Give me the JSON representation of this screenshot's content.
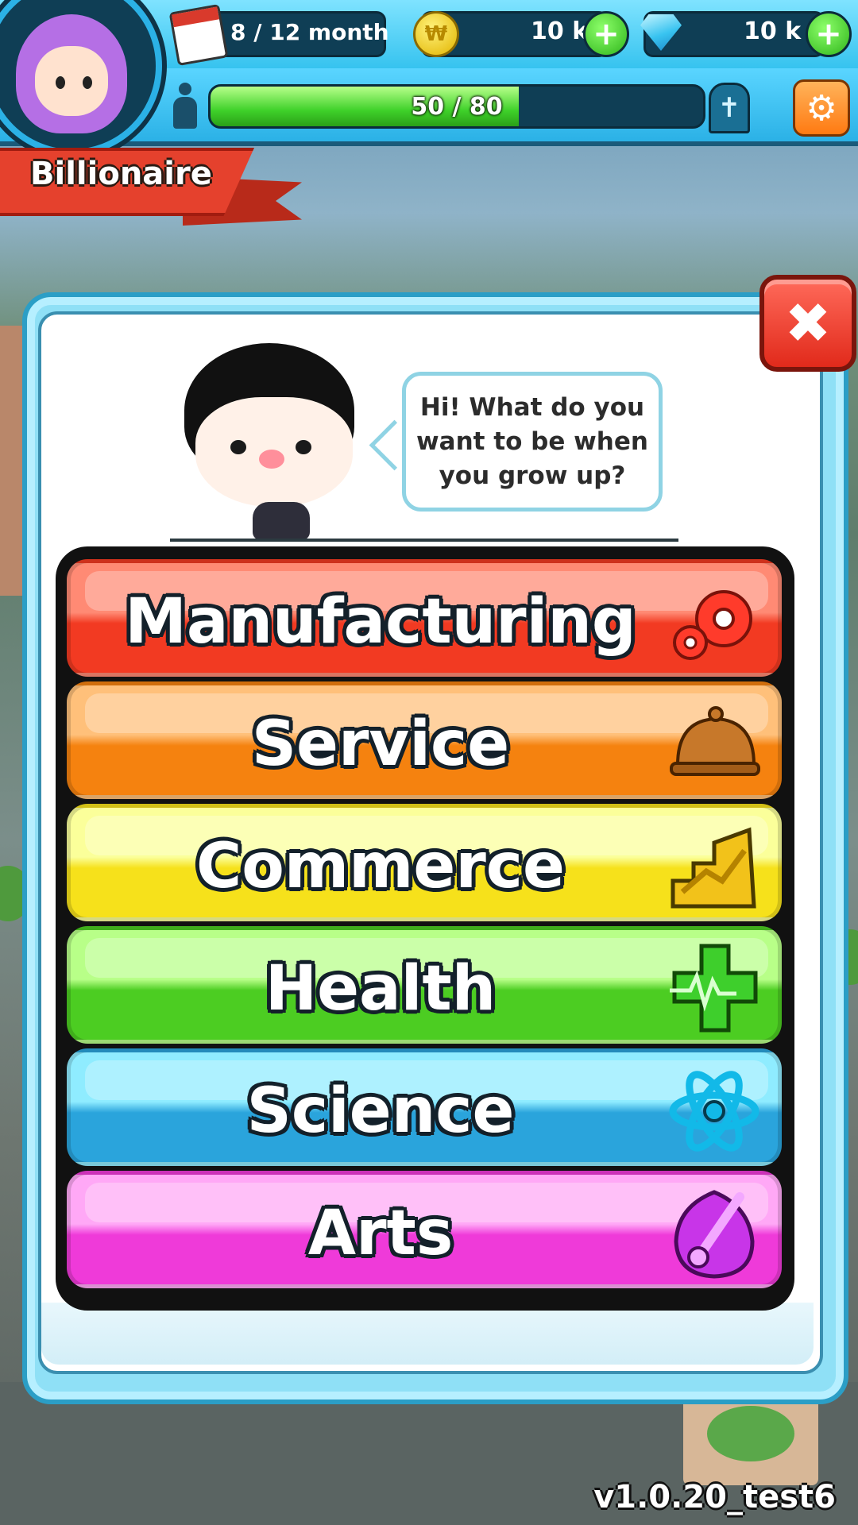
{
  "hud": {
    "date_text": "8 / 12 month",
    "coins": "10 k",
    "coin_symbol": "₩",
    "gems": "10 k",
    "plus_symbol": "+",
    "progress_text": "50 / 80",
    "progress_fraction": 0.625,
    "grave_symbol": "✝",
    "settings_symbol": "⚙"
  },
  "rank": {
    "label": "Billionaire"
  },
  "dialog": {
    "close_symbol": "✖",
    "speech": "Hi! What do you\nwant to be when\nyou grow up?"
  },
  "careers": [
    {
      "label": "Manufacturing",
      "icon": "gears-icon",
      "color_top": "#ff8a74",
      "color_bottom": "#f23a22"
    },
    {
      "label": "Service",
      "icon": "service-bell-icon",
      "color_top": "#ffc07a",
      "color_bottom": "#f5820f"
    },
    {
      "label": "Commerce",
      "icon": "growth-chart-icon",
      "color_top": "#fbff9a",
      "color_bottom": "#f6e11b"
    },
    {
      "label": "Health",
      "icon": "medical-cross-icon",
      "color_top": "#b8ff88",
      "color_bottom": "#4ccd22"
    },
    {
      "label": "Science",
      "icon": "atom-icon",
      "color_top": "#8fecff",
      "color_bottom": "#2aa4dc"
    },
    {
      "label": "Arts",
      "icon": "paintbrush-icon",
      "color_top": "#ffa8f6",
      "color_bottom": "#ef3ad9"
    }
  ],
  "footer": {
    "version": "v1.0.20_test6"
  }
}
